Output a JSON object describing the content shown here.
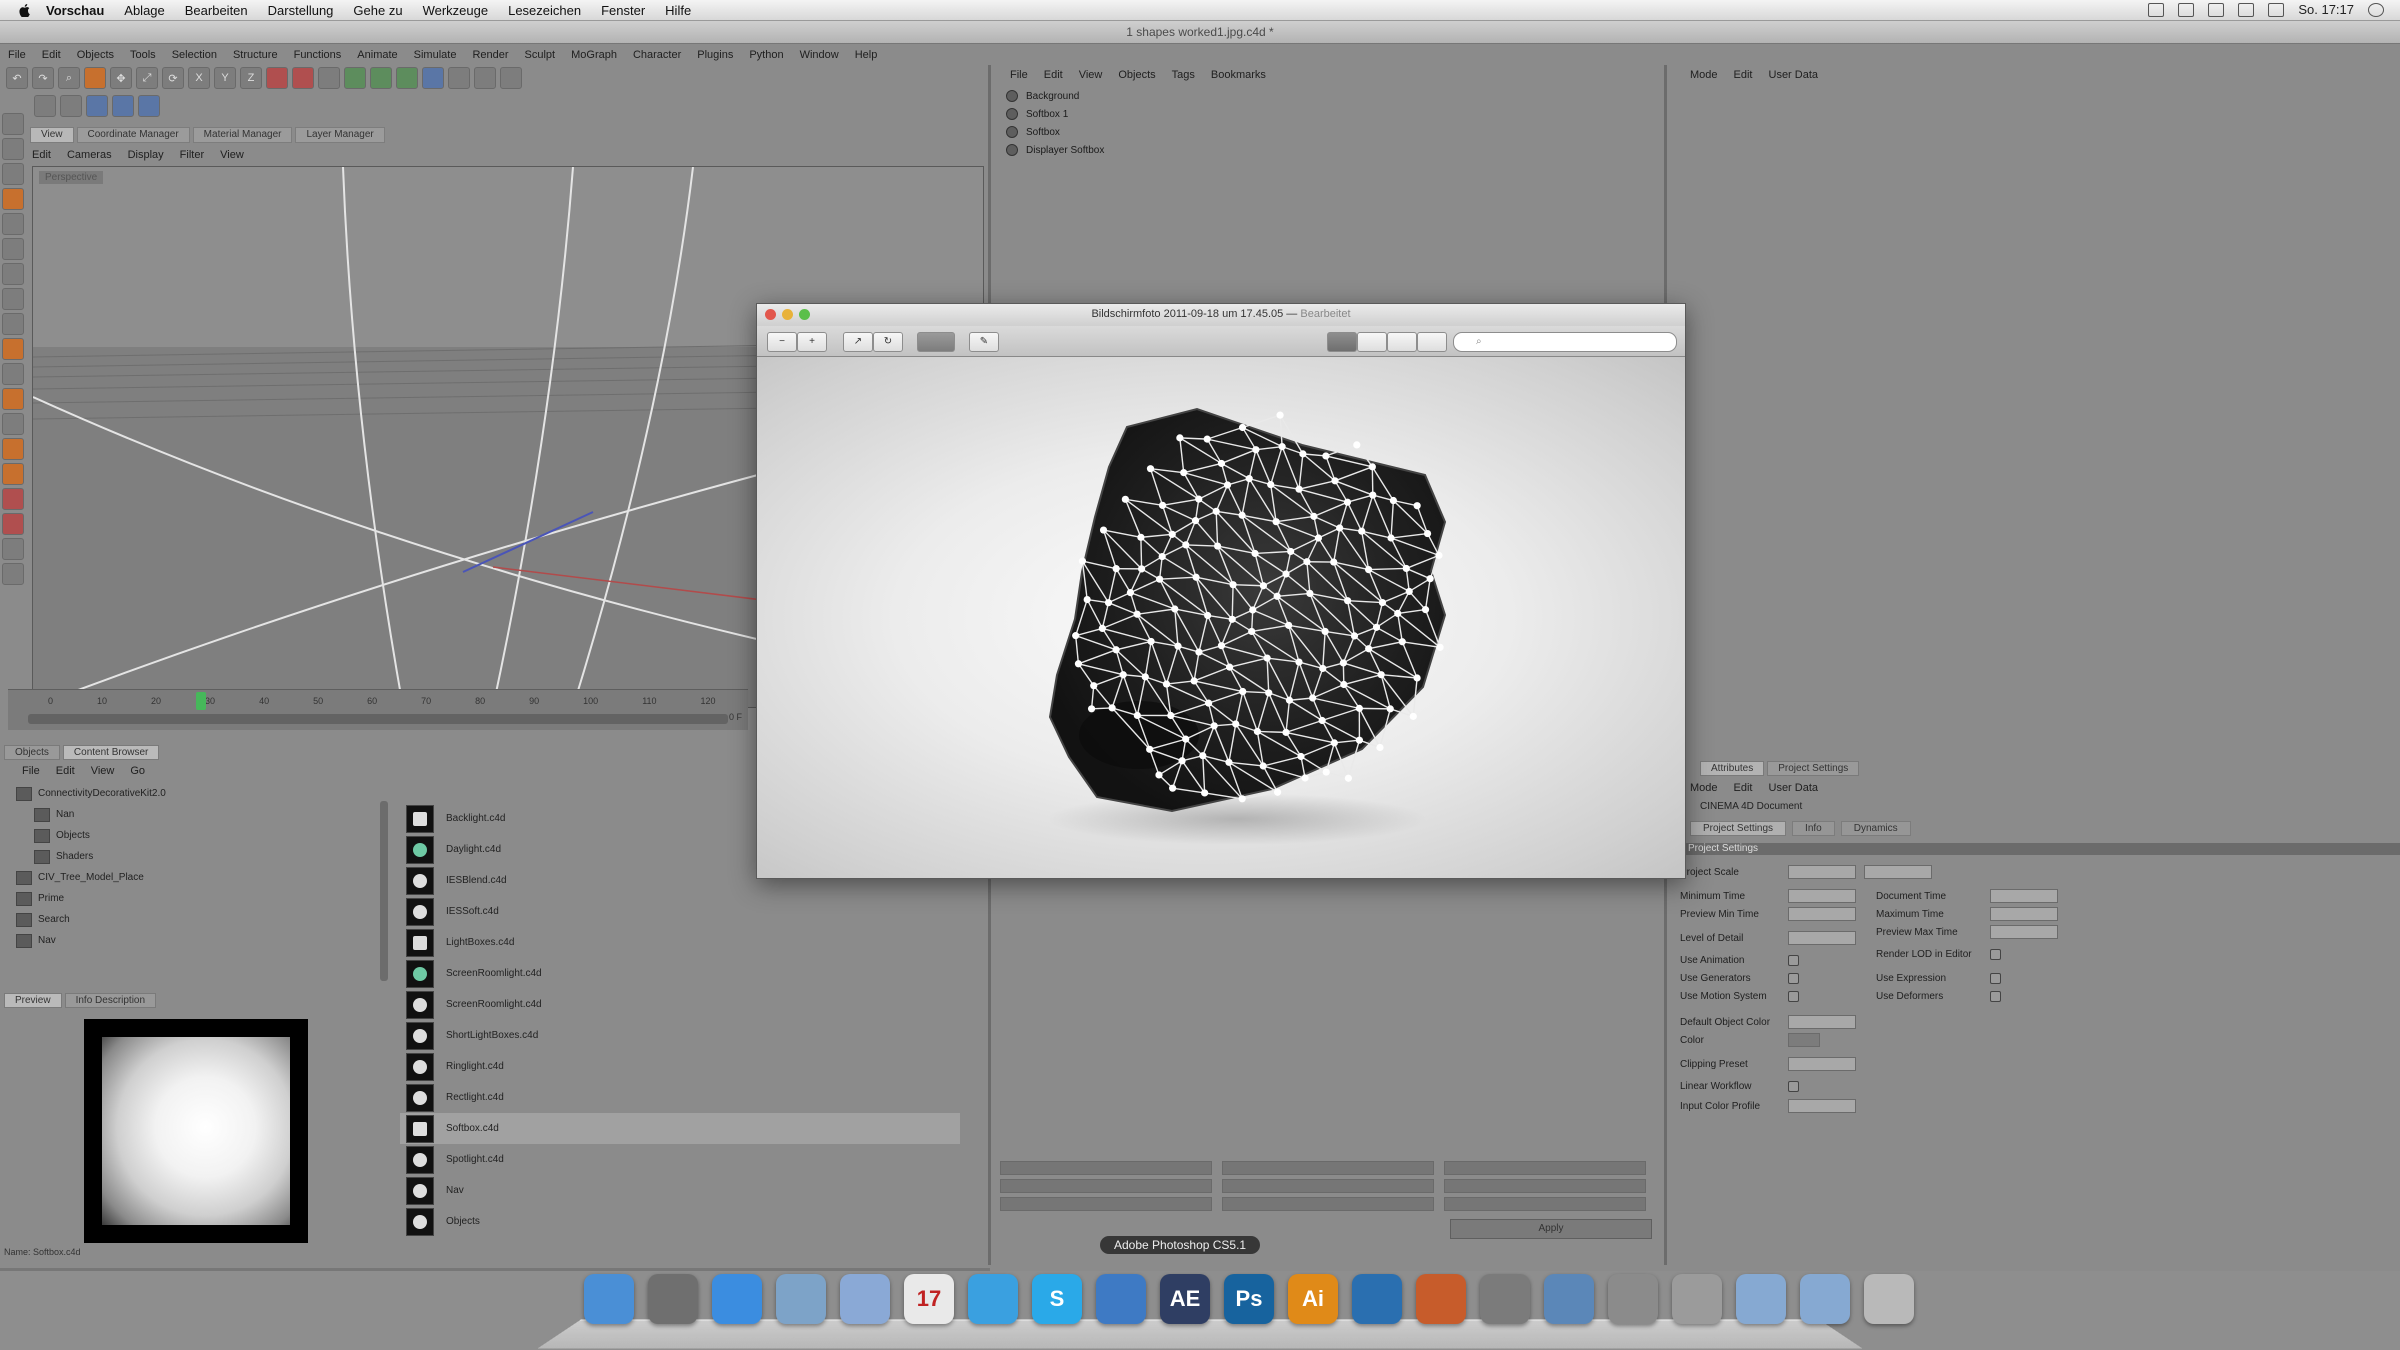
{
  "menubar": {
    "app": "Vorschau",
    "items": [
      "Ablage",
      "Bearbeiten",
      "Darstellung",
      "Gehe zu",
      "Werkzeuge",
      "Lesezeichen",
      "Fenster",
      "Hilfe"
    ],
    "clock": "So. 17:17"
  },
  "c4d": {
    "window_title": "1 shapes worked1.jpg.c4d *",
    "menu": [
      "File",
      "Edit",
      "Objects",
      "Tools",
      "Selection",
      "Structure",
      "Functions",
      "Animate",
      "Simulate",
      "Render",
      "Sculpt",
      "MoGraph",
      "Character",
      "Plugins",
      "Python",
      "Window",
      "Help"
    ],
    "viewport_tabs": [
      "View",
      "Coordinate Manager",
      "Material Manager",
      "Layer Manager"
    ],
    "viewport_menu": [
      "Edit",
      "Cameras",
      "Display",
      "Filter",
      "View"
    ],
    "viewport_label": "Perspective",
    "timeline_ticks": [
      "0",
      "10",
      "20",
      "30",
      "40",
      "50",
      "60",
      "70",
      "80",
      "90",
      "100",
      "110",
      "120"
    ],
    "timeline_current": "0 F"
  },
  "content_browser": {
    "tabs": [
      "Objects",
      "Content Browser"
    ],
    "menu": [
      "File",
      "Edit",
      "View",
      "Go"
    ],
    "tree": [
      {
        "label": "ConnectivityDecorativeKit2.0"
      },
      {
        "label": "Nan"
      },
      {
        "label": "Objects"
      },
      {
        "label": "Shaders"
      },
      {
        "label": "CIV_Tree_Model_Place"
      },
      {
        "label": "Prime"
      },
      {
        "label": "Search"
      },
      {
        "label": "Nav"
      }
    ],
    "preview_tabs": [
      "Preview",
      "Info Description"
    ],
    "preview_name": "Name: Softbox.c4d",
    "files": [
      {
        "name": "Backlight.c4d",
        "icon": "square"
      },
      {
        "name": "Daylight.c4d",
        "icon": "teal"
      },
      {
        "name": "IESBlend.c4d",
        "icon": "round"
      },
      {
        "name": "IESSoft.c4d",
        "icon": "round"
      },
      {
        "name": "LightBoxes.c4d",
        "icon": "square"
      },
      {
        "name": "ScreenRoomlight.c4d",
        "icon": "teal"
      },
      {
        "name": "ScreenRoomlight.c4d",
        "icon": "round"
      },
      {
        "name": "ShortLightBoxes.c4d",
        "icon": "round"
      },
      {
        "name": "Ringlight.c4d",
        "icon": "round"
      },
      {
        "name": "Rectlight.c4d",
        "icon": "round"
      },
      {
        "name": "Softbox.c4d",
        "icon": "square",
        "selected": true
      },
      {
        "name": "Spotlight.c4d",
        "icon": "round"
      },
      {
        "name": "Nav",
        "icon": "round"
      },
      {
        "name": "Objects",
        "icon": "round"
      }
    ]
  },
  "object_manager": {
    "menu": [
      "File",
      "Edit",
      "View",
      "Objects",
      "Tags",
      "Bookmarks"
    ],
    "objects": [
      "Background",
      "Softbox 1",
      "Softbox",
      "Displayer Softbox"
    ],
    "apply_label": "Apply"
  },
  "attributes": {
    "top_menu": [
      "Mode",
      "Edit",
      "User Data"
    ],
    "tabs": [
      "Attributes",
      "Project Settings"
    ],
    "menu": [
      "Mode",
      "Edit",
      "User Data"
    ],
    "title": "CINEMA 4D Document",
    "subtabs": [
      "Project Settings",
      "Info",
      "Dynamics"
    ],
    "section": "Project Settings",
    "rows_left": [
      "Project Scale",
      "Minimum Time",
      "Preview Min Time",
      "Level of Detail",
      "Use Animation",
      "Use Generators",
      "Use Motion System",
      "Default Object Color",
      "Color",
      "Linear Workflow",
      "Input Color Profile"
    ],
    "rows_right": [
      "Document Time",
      "Maximum Time",
      "Preview Max Time",
      "Render LOD in Editor",
      "Use Expression",
      "Use Deformers"
    ],
    "clipping_label": "Clipping Preset"
  },
  "preview": {
    "title": "Bildschirmfoto 2011-09-18 um 17.45.05",
    "title_suffix": "Bearbeitet",
    "search_placeholder": "",
    "toolbar_buttons": [
      "zoom-out",
      "zoom-in",
      "share",
      "rotate",
      "select",
      "annotate"
    ]
  },
  "dock": {
    "tooltip": "Adobe Photoshop CS5.1",
    "apps": [
      {
        "name": "Finder",
        "label": "",
        "color": "#4a8fd6"
      },
      {
        "name": "Launchpad",
        "label": "",
        "color": "#6f6f6f"
      },
      {
        "name": "Safari",
        "label": "",
        "color": "#3b8de0"
      },
      {
        "name": "Mail",
        "label": "",
        "color": "#7da3c8"
      },
      {
        "name": "Network",
        "label": "",
        "color": "#8aa9d6"
      },
      {
        "name": "Calendar",
        "label": "17",
        "color": "#e9e9e9"
      },
      {
        "name": "Twitter",
        "label": "",
        "color": "#3aa0e0"
      },
      {
        "name": "Skype",
        "label": "S",
        "color": "#2aa9e8"
      },
      {
        "name": "iTunes",
        "label": "",
        "color": "#3e7ac4"
      },
      {
        "name": "After Effects",
        "label": "AE",
        "color": "#2f3e63"
      },
      {
        "name": "Photoshop",
        "label": "Ps",
        "color": "#17639e"
      },
      {
        "name": "Illustrator",
        "label": "Ai",
        "color": "#e08a18"
      },
      {
        "name": "Cinema 4D",
        "label": "",
        "color": "#2a6fb0"
      },
      {
        "name": "Keynote",
        "label": "",
        "color": "#c75c2b"
      },
      {
        "name": "Script Editor",
        "label": "",
        "color": "#7b7b7b"
      },
      {
        "name": "Preview",
        "label": "",
        "color": "#5b87b8"
      },
      {
        "name": "System Preferences",
        "label": "",
        "color": "#8b8b8b"
      },
      {
        "name": "Utility",
        "label": "",
        "color": "#9b9b9b"
      },
      {
        "name": "Downloads",
        "label": "",
        "color": "#86a9d2"
      },
      {
        "name": "Documents",
        "label": "",
        "color": "#86a9d2"
      },
      {
        "name": "Trash",
        "label": "",
        "color": "#b9b9b9"
      }
    ]
  }
}
